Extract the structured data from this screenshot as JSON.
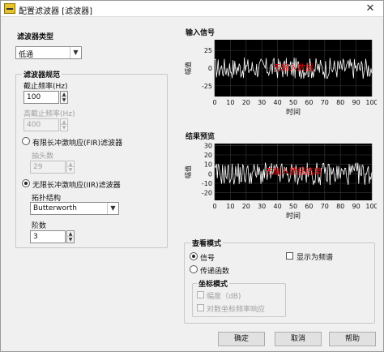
{
  "window": {
    "title": "配置滤波器 [滤波器]",
    "close_glyph": "✕"
  },
  "filter_type": {
    "heading": "滤波器类型",
    "selected": "低通"
  },
  "spec": {
    "heading": "滤波器规范",
    "cutoff_label": "截止频率(Hz)",
    "cutoff_value": "100",
    "high_cutoff_label": "高截止频率(Hz)",
    "high_cutoff_value": "400",
    "fir_label": "有限长冲激响应(FIR)滤波器",
    "taps_label": "抽头数",
    "taps_value": "29",
    "iir_label": "无限长冲激响应(IIR)滤波器",
    "topology_label": "拓扑结构",
    "topology_value": "Butterworth",
    "order_label": "阶数",
    "order_value": "3"
  },
  "input_signal": {
    "title": "输入信号",
    "ylabel": "幅值",
    "xlabel": "时间",
    "yticks": [
      "25",
      "0",
      "-25"
    ],
    "xticks": [
      "0",
      "10",
      "20",
      "30",
      "40",
      "50",
      "60",
      "70",
      "80",
      "90",
      "100"
    ],
    "annotation": "无输入数据"
  },
  "preview": {
    "title": "结果预览",
    "ylabel": "幅值",
    "xlabel": "时间",
    "yticks": [
      "30",
      "20",
      "10",
      "0",
      "-10",
      "-20"
    ],
    "xticks": [
      "0",
      "10",
      "20",
      "30",
      "40",
      "50",
      "60",
      "70",
      "80",
      "90",
      "100"
    ],
    "annotation": "无输入数据结果"
  },
  "view_mode": {
    "heading": "查看模式",
    "signal_label": "信号",
    "transfer_label": "传递函数",
    "show_freq_label": "显示为频谱",
    "coord_heading": "坐标模式",
    "db_label": "幅度（dB)",
    "log_label": "对数坐标频率响应"
  },
  "buttons": {
    "ok": "确定",
    "cancel": "取消",
    "help": "帮助"
  },
  "colors": {
    "plot_bg": "#000000",
    "trace": "#ffffff",
    "annotation": "#e01010"
  },
  "chart_data": [
    {
      "type": "line",
      "title": "输入信号",
      "xlabel": "时间",
      "ylabel": "幅值",
      "xlim": [
        0,
        100
      ],
      "ylim": [
        -40,
        40
      ],
      "noise_amplitude": 15,
      "grid": true
    },
    {
      "type": "line",
      "title": "结果预览",
      "xlabel": "时间",
      "ylabel": "幅值",
      "xlim": [
        0,
        100
      ],
      "ylim": [
        -28,
        32
      ],
      "noise_amplitude": 12,
      "grid": true
    }
  ]
}
